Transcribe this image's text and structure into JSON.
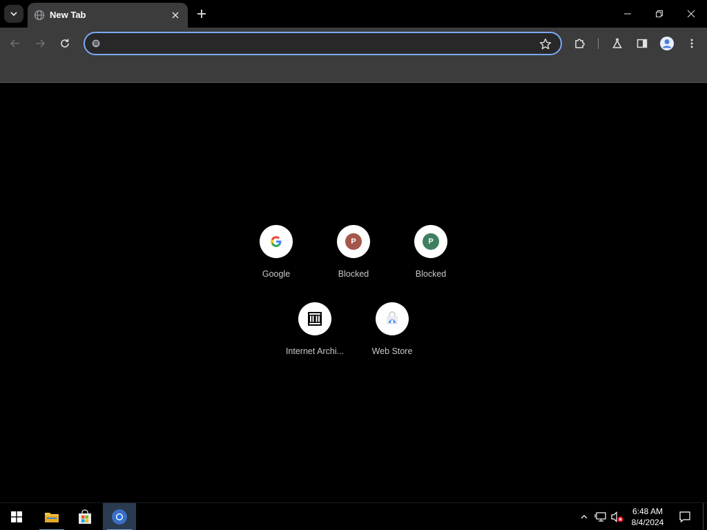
{
  "tabs": [
    {
      "title": "New Tab"
    }
  ],
  "omnibox": {
    "value": "",
    "placeholder": ""
  },
  "shortcuts": [
    {
      "label": "Google",
      "icon": "google-g-icon"
    },
    {
      "label": "Blocked",
      "icon": "letter-p-icon",
      "letter": "P",
      "color": "#a4574a"
    },
    {
      "label": "Blocked",
      "icon": "letter-p-icon",
      "letter": "P",
      "color": "#3f7f5f"
    },
    {
      "label": "Internet Archi...",
      "icon": "archive-building-icon"
    },
    {
      "label": "Web Store",
      "icon": "web-store-icon"
    }
  ],
  "taskbar": {
    "clock_time": "6:48 AM",
    "clock_date": "8/4/2024"
  },
  "colors": {
    "accent": "#7caaf7",
    "tab_bg": "#3c3c3c",
    "page_bg": "#000000"
  }
}
